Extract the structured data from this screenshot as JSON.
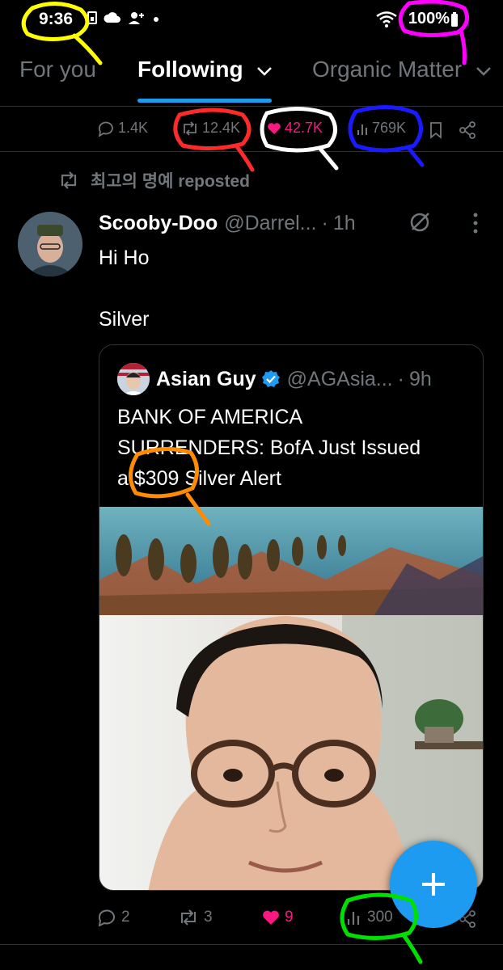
{
  "status_bar": {
    "time": "9:36",
    "battery": "100%"
  },
  "tabs": [
    {
      "label": "For you",
      "active": false
    },
    {
      "label": "Following",
      "active": true
    },
    {
      "label": "Organic Matter",
      "active": false
    }
  ],
  "previous_post_metrics": {
    "replies": "1.4K",
    "reposts": "12.4K",
    "likes": "42.7K",
    "views": "769K"
  },
  "repost_context": {
    "text": "최고의 명예 reposted"
  },
  "tweet": {
    "display_name": "Scooby-Doo",
    "handle": "@Darrel...",
    "separator": "·",
    "time": "1h",
    "text_line1": "Hi Ho",
    "text_line2": "Silver"
  },
  "quote": {
    "display_name": "Asian Guy",
    "handle": "@AGAsia...",
    "separator": "·",
    "time": "9h",
    "text_line1": "BANK OF AMERICA",
    "text_line2": "SURRENDERS: BofA Just Issued",
    "text_line3": "a $309 Silver Alert"
  },
  "actions": {
    "replies": "2",
    "reposts": "3",
    "likes": "9",
    "views": "300"
  },
  "colors": {
    "accent": "#1d9bf0",
    "like": "#f91880",
    "muted": "#71767b",
    "annotation_yellow": "#ffff00",
    "annotation_magenta": "#ff00ff",
    "annotation_red": "#ff2a2a",
    "annotation_white": "#ffffff",
    "annotation_blue": "#1a1aff",
    "annotation_orange": "#ff8c00",
    "annotation_green": "#00e000"
  },
  "icons": [
    "sim-icon",
    "cloud-icon",
    "person-add-icon",
    "wifi-icon",
    "battery-icon",
    "chevron-down-icon",
    "reply-icon",
    "repost-icon",
    "heart-icon",
    "views-icon",
    "bookmark-icon",
    "share-icon",
    "grok-icon",
    "more-icon",
    "verified-icon",
    "plus-icon"
  ]
}
